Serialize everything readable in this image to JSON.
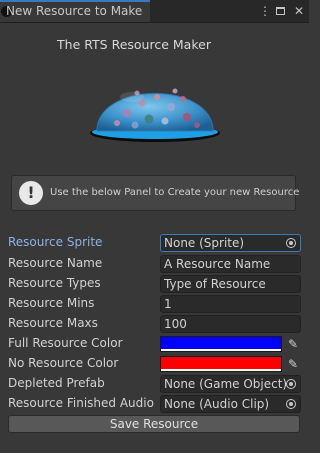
{
  "window": {
    "tab_title": "New Resource to Make",
    "menu_icon": "kebab-menu-icon",
    "maximize_icon": "maximize-icon",
    "close_icon": "close-icon"
  },
  "header": {
    "subtitle": "The RTS Resource Maker",
    "image": "resource-dome-preview"
  },
  "help": {
    "icon": "warning-icon",
    "text": "Use the below Panel to Create your new Resource"
  },
  "fields": {
    "resource_sprite": {
      "label": "Resource Sprite",
      "value": "None (Sprite)"
    },
    "resource_name": {
      "label": "Resource Name",
      "value": "A Resource Name"
    },
    "resource_types": {
      "label": "Resource Types",
      "value": "Type of Resource"
    },
    "resource_mins": {
      "label": "Resource Mins",
      "value": "1"
    },
    "resource_maxs": {
      "label": "Resource Maxs",
      "value": "100"
    },
    "full_color": {
      "label": "Full Resource Color",
      "color": "#0000ff"
    },
    "no_color": {
      "label": "No Resource Color",
      "color": "#ff0000"
    },
    "depleted_prefab": {
      "label": "Depleted Prefab",
      "value": "None (Game Object)"
    },
    "finished_audio": {
      "label": "Resource Finished Audio",
      "value": "None (Audio Clip)"
    }
  },
  "actions": {
    "save_label": "Save Resource"
  },
  "colors": {
    "accent": "#3a79bb",
    "panel": "#383838"
  }
}
